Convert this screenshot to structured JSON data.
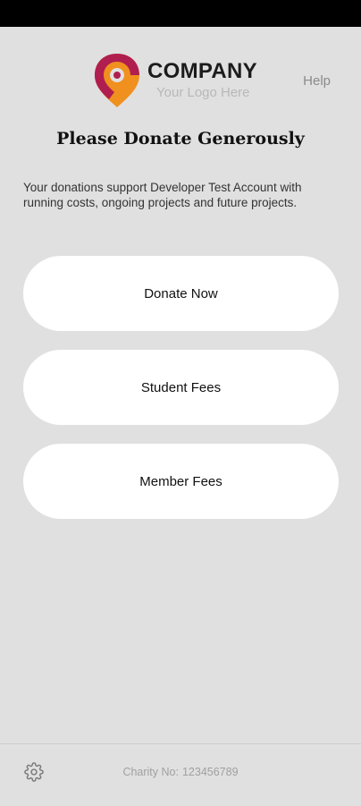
{
  "header": {
    "logo": {
      "name": "COMPANY",
      "tagline": "Your Logo Here",
      "colors": {
        "primary": "#b01e4f",
        "secondary": "#f0901e"
      }
    },
    "help_label": "Help"
  },
  "main": {
    "title": "Please Donate Generously",
    "intro": "Your donations support Developer Test Account with running costs, ongoing projects and future projects.",
    "buttons": [
      {
        "label": "Donate Now"
      },
      {
        "label": "Student Fees"
      },
      {
        "label": "Member Fees"
      }
    ]
  },
  "footer": {
    "settings_icon": "gear-icon",
    "charity_label": "Charity No:",
    "charity_number": "123456789"
  },
  "theme": {
    "background": "#e0e0e0",
    "button_background": "#ffffff",
    "status_bar": "#000000"
  }
}
